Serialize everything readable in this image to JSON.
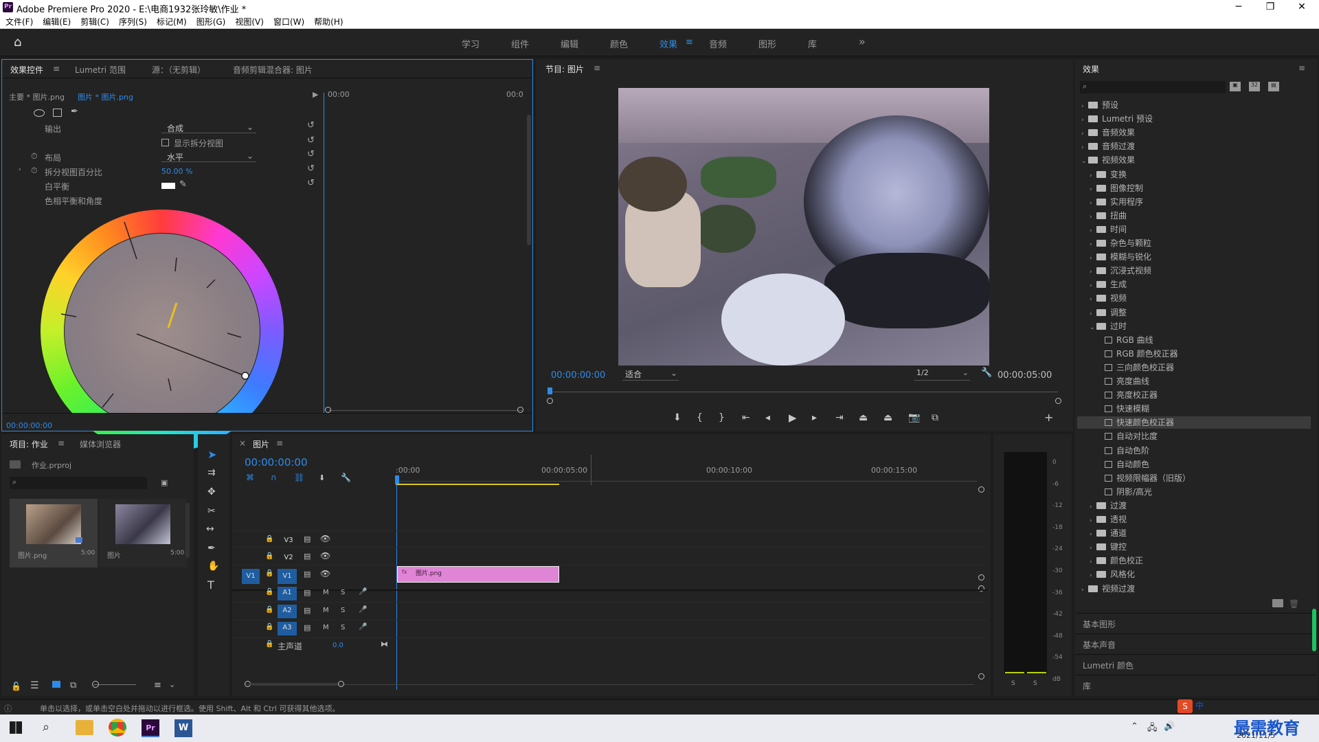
{
  "window": {
    "title": "Adobe Premiere Pro 2020 - E:\\电商1932张玲敏\\作业 *",
    "min": "─",
    "max": "❐",
    "close": "✕"
  },
  "menu": [
    "文件(F)",
    "编辑(E)",
    "剪辑(C)",
    "序列(S)",
    "标记(M)",
    "图形(G)",
    "视图(V)",
    "窗口(W)",
    "帮助(H)"
  ],
  "workspaces": [
    "学习",
    "组件",
    "编辑",
    "颜色",
    "效果",
    "音频",
    "图形",
    "库"
  ],
  "workspace_active": "效果",
  "workspace_more": "»",
  "effect_controls": {
    "tabs": [
      "效果控件",
      "Lumetri 范围",
      "源：（无剪辑）",
      "音频剪辑混合器: 图片"
    ],
    "master": "主要 * 图片.png",
    "clip": "图片 * 图片.png",
    "ruler_start": "00:00",
    "ruler_end": "00:0",
    "props": {
      "output_label": "输出",
      "output_value": "合成",
      "split_label": "显示拆分视图",
      "layout_label": "布局",
      "layout_value": "水平",
      "split_pct_label": "拆分视图百分比",
      "split_pct_value": "50.00 %",
      "wb_label": "白平衡",
      "hue_label": "色相平衡和角度"
    },
    "timecode": "00:00:00:00"
  },
  "program": {
    "title": "节目: 图片",
    "timecode": "00:00:00:00",
    "fit": "适合",
    "quality": "1/2",
    "duration": "00:00:05:00"
  },
  "effects": {
    "title": "效果",
    "items": [
      {
        "label": "预设",
        "level": 0,
        "type": "folder",
        "arrow": "›"
      },
      {
        "label": "Lumetri 预设",
        "level": 0,
        "type": "folder",
        "arrow": "›"
      },
      {
        "label": "音频效果",
        "level": 0,
        "type": "folder",
        "arrow": "›"
      },
      {
        "label": "音频过渡",
        "level": 0,
        "type": "folder",
        "arrow": "›"
      },
      {
        "label": "视频效果",
        "level": 0,
        "type": "folder",
        "arrow": "⌄"
      },
      {
        "label": "变换",
        "level": 1,
        "type": "folder",
        "arrow": "›"
      },
      {
        "label": "图像控制",
        "level": 1,
        "type": "folder",
        "arrow": "›"
      },
      {
        "label": "实用程序",
        "level": 1,
        "type": "folder",
        "arrow": "›"
      },
      {
        "label": "扭曲",
        "level": 1,
        "type": "folder",
        "arrow": "›"
      },
      {
        "label": "时间",
        "level": 1,
        "type": "folder",
        "arrow": "›"
      },
      {
        "label": "杂色与颗粒",
        "level": 1,
        "type": "folder",
        "arrow": "›"
      },
      {
        "label": "模糊与锐化",
        "level": 1,
        "type": "folder",
        "arrow": "›"
      },
      {
        "label": "沉浸式视频",
        "level": 1,
        "type": "folder",
        "arrow": "›"
      },
      {
        "label": "生成",
        "level": 1,
        "type": "folder",
        "arrow": "›"
      },
      {
        "label": "视频",
        "level": 1,
        "type": "folder",
        "arrow": "›"
      },
      {
        "label": "调整",
        "level": 1,
        "type": "folder",
        "arrow": "›"
      },
      {
        "label": "过时",
        "level": 1,
        "type": "folder",
        "arrow": "⌄"
      },
      {
        "label": "RGB 曲线",
        "level": 2,
        "type": "fx",
        "arrow": ""
      },
      {
        "label": "RGB 颜色校正器",
        "level": 2,
        "type": "fx",
        "arrow": ""
      },
      {
        "label": "三向颜色校正器",
        "level": 2,
        "type": "fx",
        "arrow": ""
      },
      {
        "label": "亮度曲线",
        "level": 2,
        "type": "fx",
        "arrow": ""
      },
      {
        "label": "亮度校正器",
        "level": 2,
        "type": "fx",
        "arrow": ""
      },
      {
        "label": "快速模糊",
        "level": 2,
        "type": "fx",
        "arrow": ""
      },
      {
        "label": "快速颜色校正器",
        "level": 2,
        "type": "fx",
        "arrow": "",
        "selected": true
      },
      {
        "label": "自动对比度",
        "level": 2,
        "type": "fx",
        "arrow": ""
      },
      {
        "label": "自动色阶",
        "level": 2,
        "type": "fx",
        "arrow": ""
      },
      {
        "label": "自动颜色",
        "level": 2,
        "type": "fx",
        "arrow": ""
      },
      {
        "label": "视频限幅器（旧版）",
        "level": 2,
        "type": "fx",
        "arrow": ""
      },
      {
        "label": "阴影/高光",
        "level": 2,
        "type": "fx",
        "arrow": ""
      },
      {
        "label": "过渡",
        "level": 1,
        "type": "folder",
        "arrow": "›"
      },
      {
        "label": "透视",
        "level": 1,
        "type": "folder",
        "arrow": "›"
      },
      {
        "label": "通道",
        "level": 1,
        "type": "folder",
        "arrow": "›"
      },
      {
        "label": "键控",
        "level": 1,
        "type": "folder",
        "arrow": "›"
      },
      {
        "label": "颜色校正",
        "level": 1,
        "type": "folder",
        "arrow": "›"
      },
      {
        "label": "风格化",
        "level": 1,
        "type": "folder",
        "arrow": "›"
      },
      {
        "label": "视频过渡",
        "level": 0,
        "type": "folder",
        "arrow": "›"
      }
    ],
    "sections": [
      "基本图形",
      "基本声音",
      "Lumetri 颜色",
      "库"
    ]
  },
  "project": {
    "tabs": [
      "项目: 作业",
      "媒体浏览器"
    ],
    "file": "作业.prproj",
    "items": [
      {
        "name": "图片.png",
        "dur": "5:00"
      },
      {
        "name": "图片",
        "dur": "5:00"
      }
    ]
  },
  "timeline": {
    "tab": "图片",
    "timecode": "00:00:00:00",
    "ruler": [
      ":00:00",
      "00:00:05:00",
      "00:00:10:00",
      "00:00:15:00"
    ],
    "tracks_video": [
      "V3",
      "V2",
      "V1"
    ],
    "tracks_audio": [
      "A1",
      "A2",
      "A3"
    ],
    "source_v": "V1",
    "master_label": "主声道",
    "master_value": "0.0",
    "m_label": "M",
    "s_label": "S",
    "clip_name": "图片.png",
    "clip_fx": "fx"
  },
  "meter": {
    "scale": [
      "0",
      "-6",
      "-12",
      "-18",
      "-24",
      "-30",
      "-36",
      "-42",
      "-48",
      "-54",
      "dB"
    ],
    "s_left": "S",
    "s_right": "S"
  },
  "status": {
    "text": "单击以选择，或单击空白处并拖动以进行框选。使用 Shift、Alt 和 Ctrl 可获得其他选项。"
  },
  "taskbar": {
    "date": "2021/11/5",
    "brand": "最需教育",
    "ime": "中"
  }
}
